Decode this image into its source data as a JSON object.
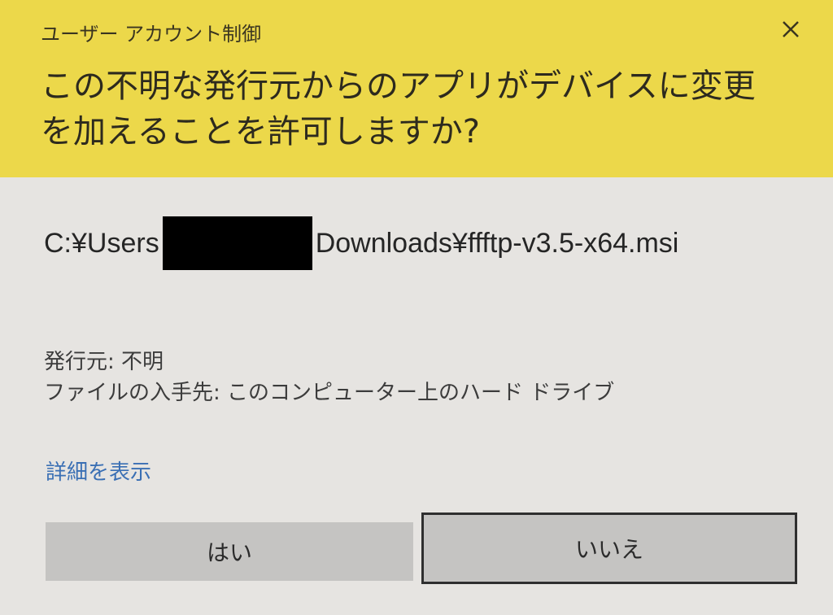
{
  "window": {
    "title": "ユーザー アカウント制御",
    "close_icon": "close-icon"
  },
  "prompt": {
    "text": "この不明な発行元からのアプリがデバイスに変更を加えることを許可しますか?"
  },
  "file": {
    "path_before_redaction": "C:¥Users",
    "path_after_redaction": "Downloads¥ffftp-v3.5-x64.msi"
  },
  "details": {
    "publisher": "発行元: 不明",
    "origin": "ファイルの入手先: このコンピューター上のハード ドライブ"
  },
  "links": {
    "show_details": "詳細を表示"
  },
  "buttons": {
    "yes": "はい",
    "no": "いいえ"
  },
  "colors": {
    "header": "#ecd84a",
    "body": "#e6e4e1",
    "link": "#3a6fb4"
  }
}
